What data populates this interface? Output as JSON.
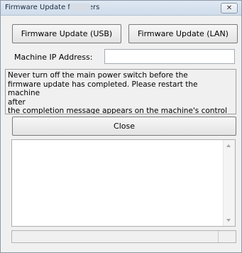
{
  "window": {
    "title": "Firmware Update for Users",
    "close_glyph": "✕"
  },
  "buttons": {
    "usb_label": "Firmware Update (USB)",
    "lan_label": "Firmware Update (LAN)",
    "close_label": "Close"
  },
  "ip": {
    "label": "Machine IP Address:",
    "value": ""
  },
  "notice": {
    "text": "Never turn off the main power switch before the\nfirmware update has completed. Please restart the machine\nafter\nthe completion message appears on the machine's control"
  },
  "log": {
    "content": ""
  },
  "icons": {
    "close": "close-icon",
    "scroll_up": "scroll-up-arrow-icon",
    "scroll_down": "scroll-down-arrow-icon"
  }
}
